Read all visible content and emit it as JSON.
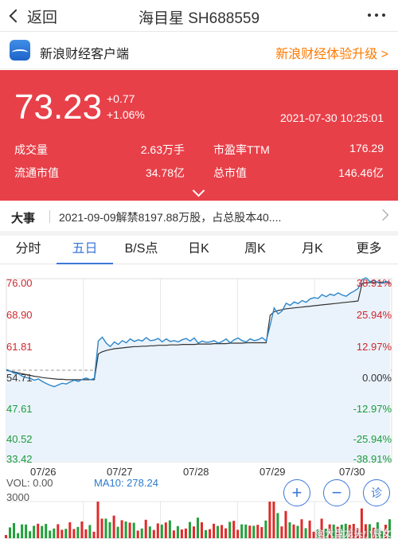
{
  "header": {
    "back_label": "返回",
    "title": "海目星 SH688559"
  },
  "banner": {
    "app_name": "新浪财经客户端",
    "upgrade_label": "新浪财经体验升级 >"
  },
  "quote": {
    "price": "73.23",
    "change": "+0.77",
    "change_pct": "+1.06%",
    "datetime": "2021-07-30 10:25:01",
    "stats": {
      "volume_label": "成交量",
      "volume_value": "2.63万手",
      "pe_label": "市盈率TTM",
      "pe_value": "176.29",
      "float_cap_label": "流通市值",
      "float_cap_value": "34.78亿",
      "total_cap_label": "总市值",
      "total_cap_value": "146.46亿"
    },
    "accent_color": "#e84049"
  },
  "event": {
    "tag": "大事",
    "text": "2021-09-09解禁8197.88万股，占总股本40...."
  },
  "tabs": [
    {
      "label": "分时"
    },
    {
      "label": "五日",
      "active": true
    },
    {
      "label": "B/S点"
    },
    {
      "label": "日K"
    },
    {
      "label": "周K"
    },
    {
      "label": "月K"
    },
    {
      "label": "更多"
    }
  ],
  "chart_data": {
    "type": "line",
    "title": "",
    "x_labels": [
      "07/26",
      "07/27",
      "07/28",
      "07/29",
      "07/30"
    ],
    "y_left_ticks": [
      "76.00",
      "68.90",
      "61.81",
      "54.71",
      "47.61",
      "40.52",
      "33.42"
    ],
    "y_right_ticks": [
      "38.91%",
      "25.94%",
      "12.97%",
      "0.00%",
      "-12.97%",
      "-25.94%",
      "-38.91%"
    ],
    "ylim": [
      33.42,
      76.0
    ],
    "reference_price": 54.71,
    "series": [
      {
        "values": [
          54.9,
          54.5,
          54.0,
          53.9,
          53.3,
          53.0,
          52.8,
          52.4,
          52.7,
          52.1,
          51.6,
          51.2,
          50.9,
          51.3,
          51.7,
          51.5,
          52.0,
          52.4,
          52.1,
          52.6,
          52.9,
          52.5,
          52.8,
          61.5,
          62.4,
          61.0,
          60.2,
          61.3,
          60.7,
          61.6,
          61.1,
          62.0,
          61.4,
          61.8,
          61.5,
          62.3,
          61.6,
          61.7,
          62.1,
          61.3,
          62.0,
          61.4,
          61.6,
          61.3,
          61.8,
          62.1,
          61.5,
          62.2,
          61.0,
          61.5,
          61.2,
          61.3,
          61.6,
          61.0,
          61.4,
          62.0,
          61.1,
          61.8,
          62.2,
          61.6,
          61.3,
          62.0,
          61.6,
          61.8,
          62.3,
          61.5,
          65.2,
          69.2,
          67.8,
          68.5,
          70.3,
          69.8,
          70.6,
          70.2,
          70.9,
          70.5,
          71.3,
          71.6,
          71.4,
          72.3,
          71.8,
          72.4,
          72.1,
          72.7,
          72.2,
          71.9,
          72.6,
          73.1,
          73.7,
          75.8,
          76.2,
          75.3,
          75.6,
          75.1,
          74.9,
          75.4,
          74.7
        ]
      },
      {
        "values": [
          54.7,
          54.5,
          54.3,
          54.1,
          53.9,
          53.7,
          53.5,
          53.3,
          53.2,
          53.0,
          52.9,
          52.8,
          52.7,
          52.6,
          52.6,
          52.5,
          52.5,
          52.5,
          52.5,
          52.5,
          52.5,
          52.5,
          52.5,
          58.5,
          59.0,
          59.3,
          59.5,
          59.7,
          59.8,
          59.9,
          60.0,
          60.1,
          60.2,
          60.2,
          60.3,
          60.3,
          60.4,
          60.4,
          60.5,
          60.5,
          60.5,
          60.6,
          60.6,
          60.6,
          60.7,
          60.7,
          60.7,
          60.7,
          60.8,
          60.8,
          60.8,
          60.8,
          60.9,
          60.9,
          60.9,
          60.9,
          61.0,
          61.0,
          61.0,
          61.0,
          61.1,
          61.1,
          61.1,
          61.1,
          61.1,
          61.1,
          67.5,
          68.3,
          68.6,
          68.8,
          69.0,
          69.1,
          69.2,
          69.3,
          69.4,
          69.5,
          69.6,
          69.7,
          69.8,
          69.9,
          70.0,
          70.1,
          70.2,
          70.3,
          70.4,
          70.5,
          70.6,
          70.7,
          70.8,
          74.9,
          75.0,
          75.1,
          75.1,
          75.2,
          75.2,
          75.2,
          75.2
        ]
      }
    ],
    "volume": {
      "vol_label": "VOL: 0.00",
      "ma10_label": "MA10: 278.24",
      "max_tick": "3000"
    },
    "colors": {
      "price_line": "#2c86c9",
      "avg_line": "#333333",
      "area_fill": "#eaf3fb",
      "up": "#e02a2a",
      "down": "#23a03c"
    }
  },
  "controls": {
    "zoom_in": "+",
    "zoom_out": "−",
    "diagnose": "诊"
  },
  "watermark": "@大盘龙头小辰女"
}
